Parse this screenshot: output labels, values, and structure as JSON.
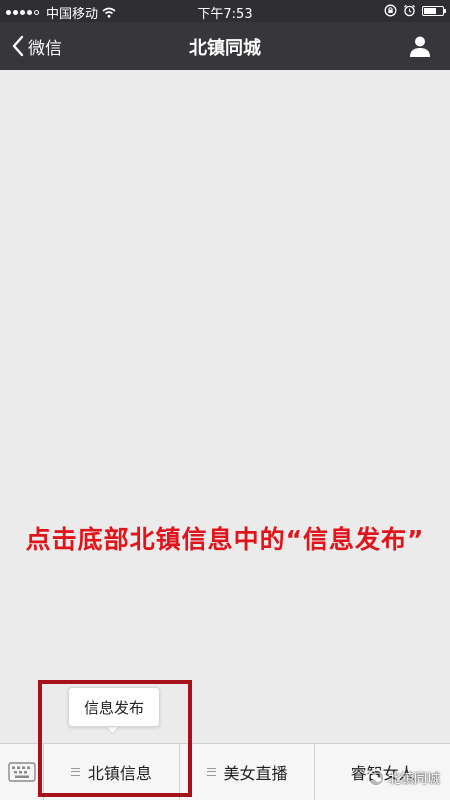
{
  "status_bar": {
    "carrier": "中国移动",
    "time": "下午7:53",
    "signal_bars_on": 4,
    "signal_bars_total": 5,
    "icons": [
      "wifi-icon",
      "rotation-lock-icon",
      "alarm-icon",
      "battery-icon"
    ]
  },
  "nav": {
    "back_label": "微信",
    "title": "北镇同城",
    "back_icon": "chevron-left-icon",
    "profile_icon": "person-icon"
  },
  "content": {
    "instruction": "点击底部北镇信息中的“信息发布”"
  },
  "popup": {
    "item_label": "信息发布"
  },
  "bottom_menu": {
    "keyboard_icon": "keyboard-icon",
    "items": [
      {
        "label": "北镇信息"
      },
      {
        "label": "美女直播"
      },
      {
        "label": "睿智女人"
      }
    ]
  },
  "watermark": {
    "text": "北镇同城"
  },
  "colors": {
    "status_bar_bg": "#2f2f33",
    "nav_bg": "#37373b",
    "content_bg": "#ebebeb",
    "instruction_text": "#e0151b",
    "highlight_border": "#a6111c",
    "bottom_bar_bg": "#f6f6f6"
  }
}
